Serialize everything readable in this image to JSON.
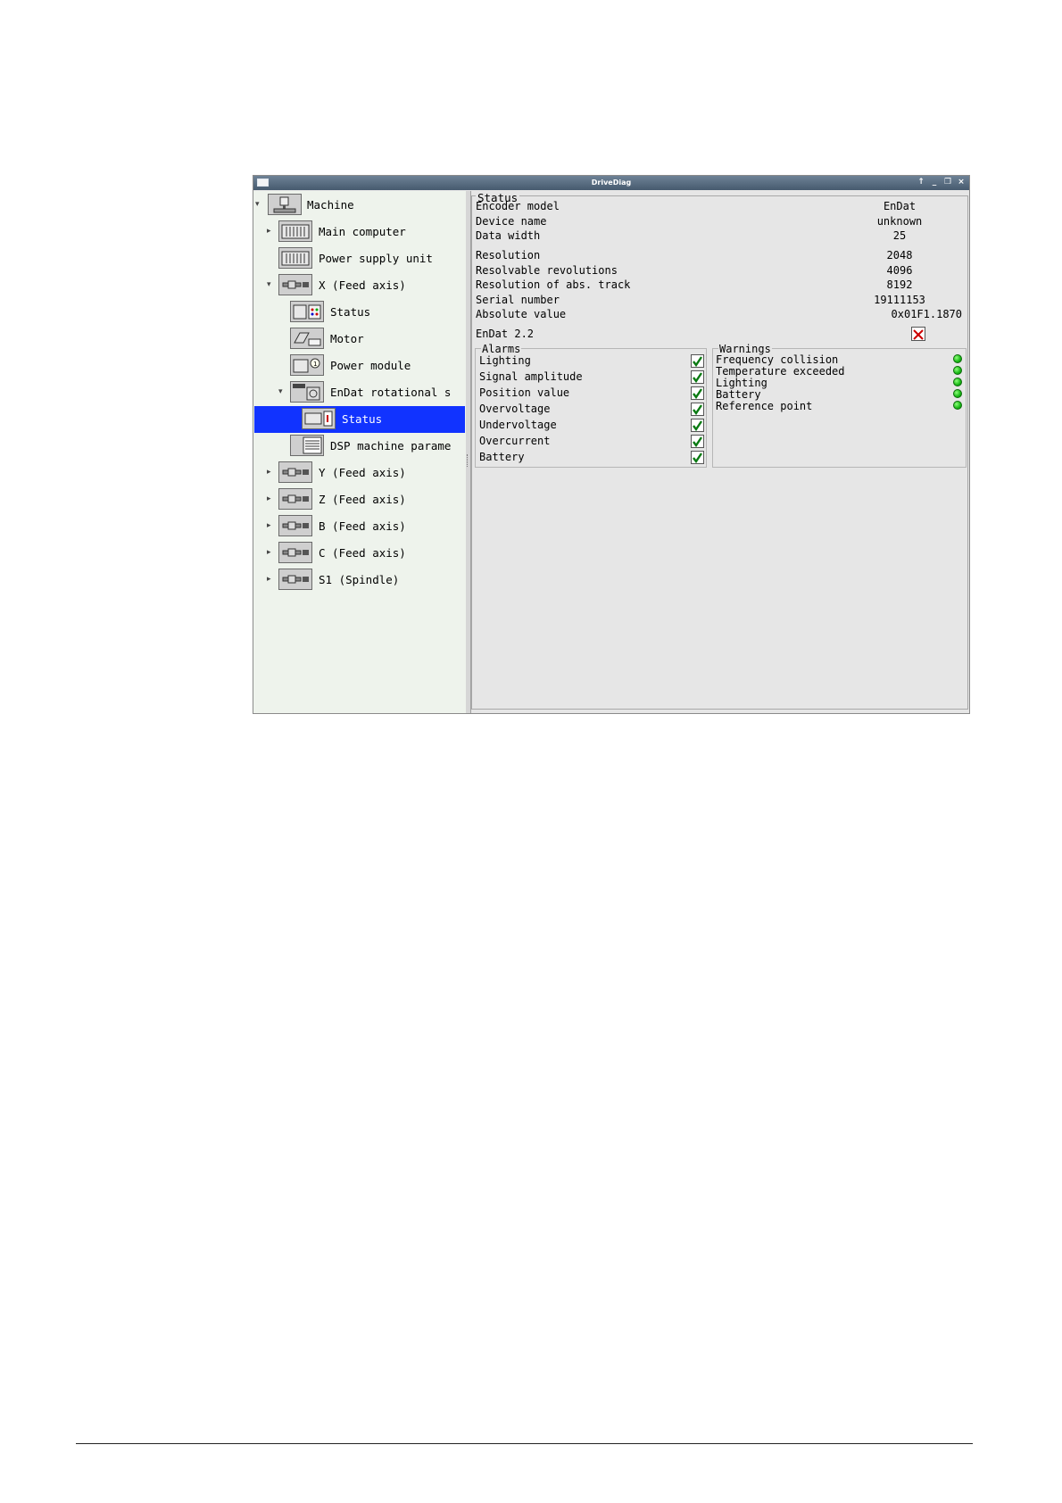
{
  "window": {
    "title": "DriveDiag",
    "buttons": [
      "↑",
      "_",
      "❐",
      "×"
    ]
  },
  "tree": {
    "nodes": [
      {
        "label": "Machine",
        "icon": "machine-icon",
        "expanded": true
      },
      {
        "label": "Main computer",
        "icon": "computer-icon"
      },
      {
        "label": "Power supply unit",
        "icon": "power-supply-icon"
      },
      {
        "label": "X (Feed axis)",
        "icon": "axis-icon",
        "expanded": true
      },
      {
        "label": "Status",
        "icon": "status-icon"
      },
      {
        "label": "Motor",
        "icon": "motor-icon"
      },
      {
        "label": "Power module",
        "icon": "power-module-icon"
      },
      {
        "label": "EnDat rotational s",
        "icon": "encoder-icon",
        "expanded": true
      },
      {
        "label": "Status",
        "icon": "encoder-status-icon",
        "selected": true
      },
      {
        "label": "DSP machine parame",
        "icon": "parameters-icon"
      },
      {
        "label": "Y (Feed axis)",
        "icon": "axis-icon"
      },
      {
        "label": "Z (Feed axis)",
        "icon": "axis-icon"
      },
      {
        "label": "B (Feed axis)",
        "icon": "axis-icon"
      },
      {
        "label": "C (Feed axis)",
        "icon": "axis-icon"
      },
      {
        "label": "S1 (Spindle)",
        "icon": "axis-icon"
      }
    ]
  },
  "status": {
    "title": "Status",
    "fields": [
      {
        "key": "Encoder model",
        "value": "EnDat"
      },
      {
        "key": "Device name",
        "value": "unknown"
      },
      {
        "key": "Data width",
        "value": "25"
      },
      {
        "key": "Resolution",
        "value": "2048"
      },
      {
        "key": "Resolvable revolutions",
        "value": "4096"
      },
      {
        "key": "Resolution of abs. track",
        "value": "8192"
      },
      {
        "key": "Serial number",
        "value": "19111153"
      },
      {
        "key": "Absolute value",
        "value": "0x01F1.1870"
      }
    ],
    "endat22": {
      "label": "EnDat 2.2",
      "checked": false
    }
  },
  "alarms": {
    "title": "Alarms",
    "items": [
      {
        "label": "Lighting",
        "checked": true
      },
      {
        "label": "Signal amplitude",
        "checked": true
      },
      {
        "label": "Position value",
        "checked": true
      },
      {
        "label": "Overvoltage",
        "checked": true
      },
      {
        "label": "Undervoltage",
        "checked": true
      },
      {
        "label": "Overcurrent",
        "checked": true
      },
      {
        "label": "Battery",
        "checked": true
      }
    ]
  },
  "warnings": {
    "title": "Warnings",
    "items": [
      {
        "label": "Frequency collision",
        "status": "ok"
      },
      {
        "label": "Temperature exceeded",
        "status": "ok"
      },
      {
        "label": "Lighting",
        "status": "ok"
      },
      {
        "label": "Battery",
        "status": "ok"
      },
      {
        "label": "Reference point",
        "status": "ok"
      }
    ]
  },
  "colors": {
    "selection": "#1133ff",
    "ok_indicator": "#17b814",
    "check": "#0a7a12",
    "error_x": "#cc0000"
  }
}
